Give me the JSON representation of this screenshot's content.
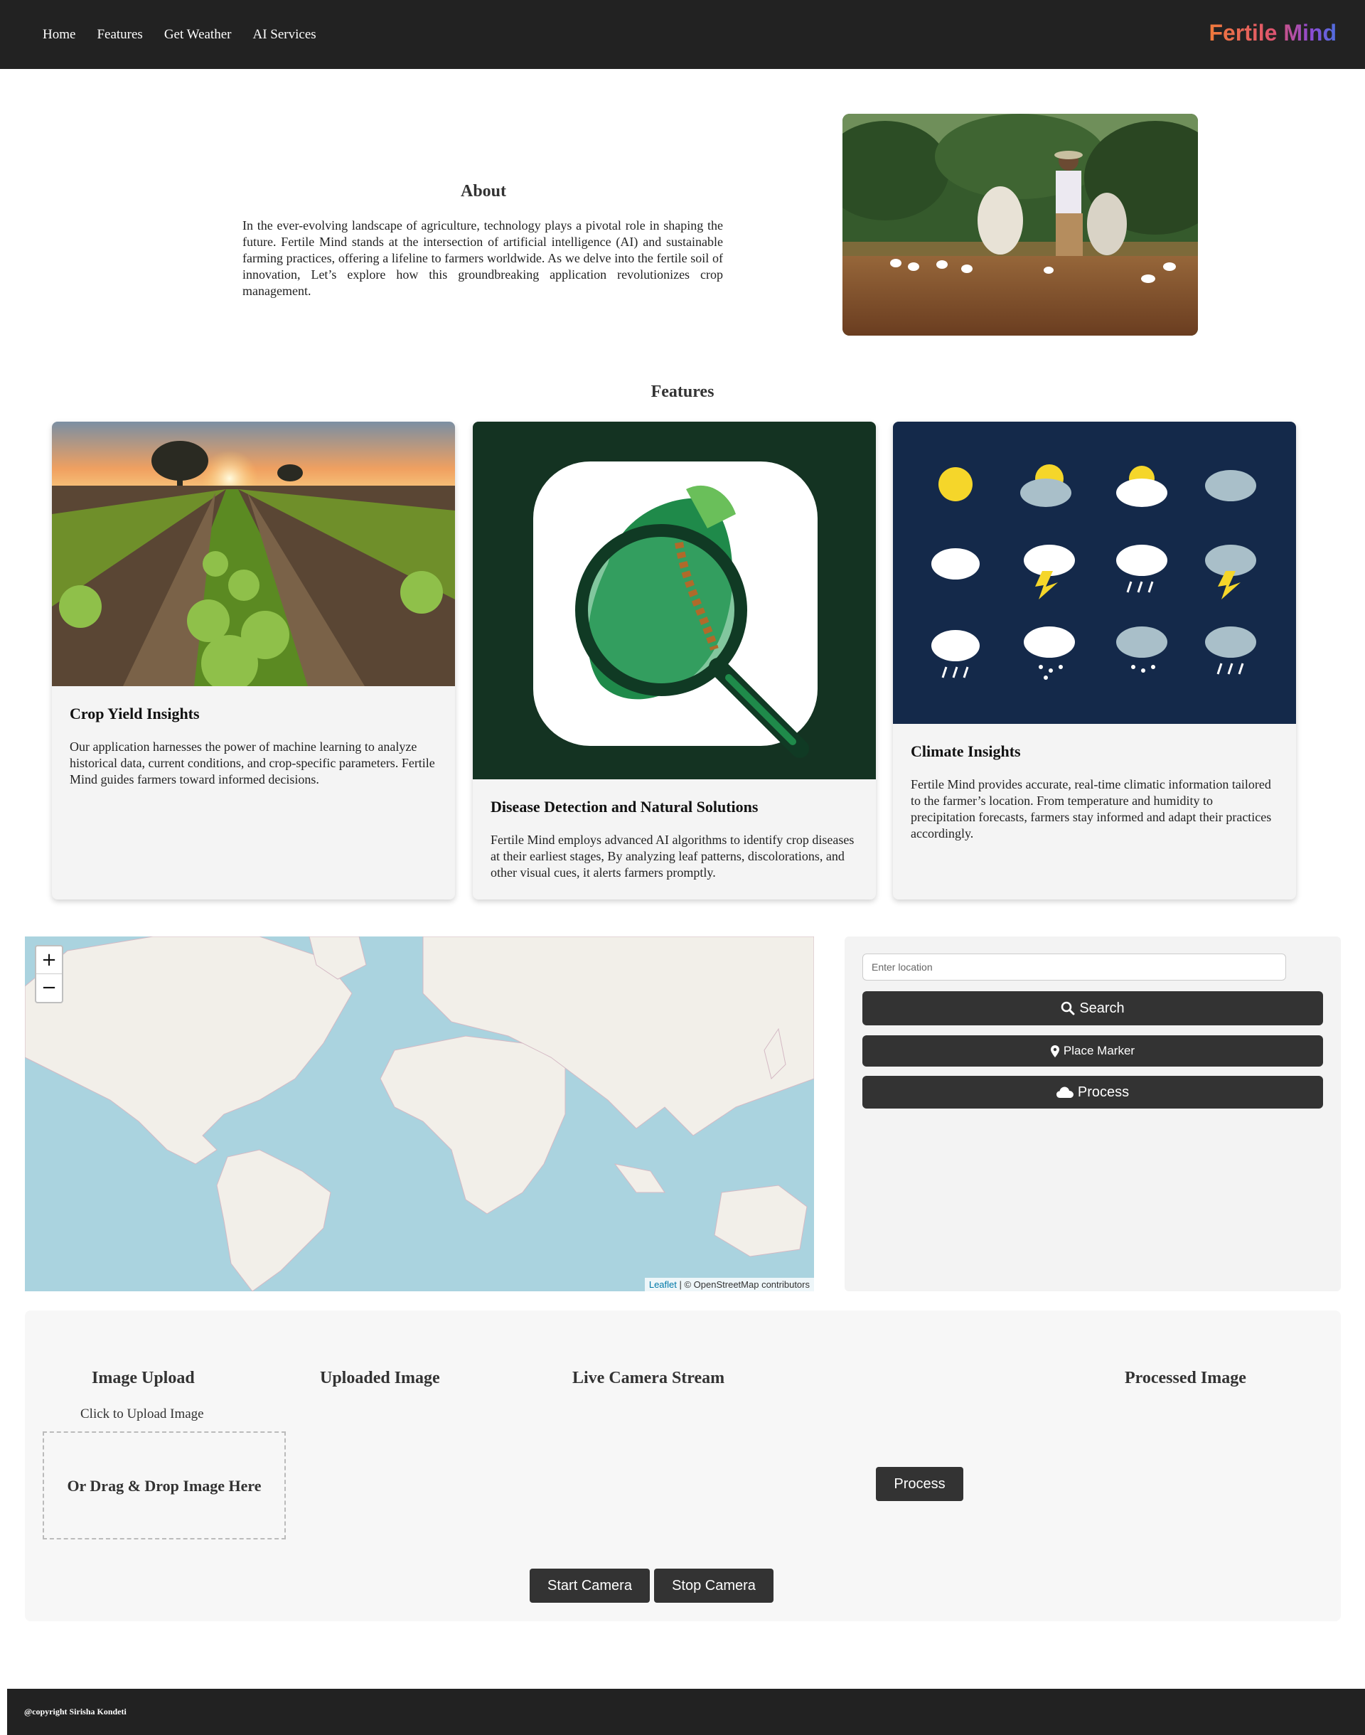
{
  "nav": {
    "links": [
      "Home",
      "Features",
      "Get Weather",
      "AI Services"
    ],
    "brand": "Fertile Mind"
  },
  "about": {
    "title": "About",
    "text": "In the ever-evolving landscape of agriculture, technology plays a pivotal role in shaping the future. Fertile Mind stands at the intersection of artificial intelligence (AI) and sustainable farming practices, offering a lifeline to farmers worldwide. As we delve into the fertile soil of innovation, Let’s explore how this groundbreaking application revolutionizes crop management."
  },
  "features": {
    "title": "Features",
    "cards": [
      {
        "title": "Crop Yield Insights",
        "text": "Our application harnesses the power of machine learning to analyze historical data, current conditions, and crop-specific parameters. Fertile Mind guides farmers toward informed decisions."
      },
      {
        "title": "Disease Detection and Natural Solutions",
        "text": "Fertile Mind employs advanced AI algorithms to identify crop diseases at their earliest stages, By analyzing leaf patterns, discolorations, and other visual cues, it alerts farmers promptly."
      },
      {
        "title": "Climate Insights",
        "text": "Fertile Mind provides accurate, real-time climatic information tailored to the farmer’s location. From temperature and humidity to precipitation forecasts, farmers stay informed and adapt their practices accordingly."
      }
    ]
  },
  "map": {
    "zoom_in": "+",
    "zoom_out": "−",
    "attribution_link": "Leaflet",
    "attribution_rest": " | © OpenStreetMap contributors"
  },
  "weather_panel": {
    "location_placeholder": "Enter location",
    "search_label": "Search",
    "place_marker_label": "Place Marker",
    "process_label": "Process"
  },
  "ai_services": {
    "image_upload_title": "Image Upload",
    "click_to_upload": "Click to Upload Image",
    "drop_text": "Or Drag & Drop Image Here",
    "uploaded_image_title": "Uploaded Image",
    "live_camera_title": "Live Camera Stream",
    "processed_image_title": "Processed Image",
    "process_label": "Process",
    "start_camera_label": "Start Camera",
    "stop_camera_label": "Stop Camera"
  },
  "footer": {
    "text": "@copyright Sirisha Kondeti"
  },
  "colors": {
    "nav_bg": "#222222",
    "button_bg": "#333333",
    "card_bg": "#f4f4f4",
    "map_water": "#aad3df",
    "map_land": "#f2efe9"
  }
}
